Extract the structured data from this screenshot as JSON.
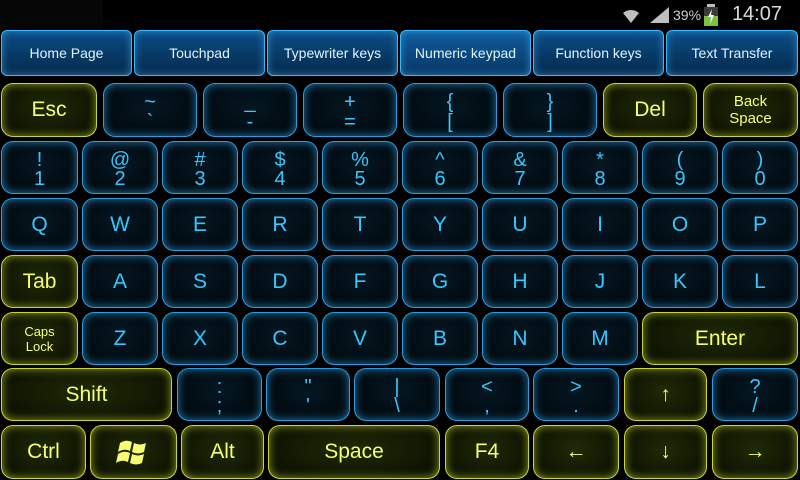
{
  "status_bar": {
    "battery": "39%",
    "time": "14:07"
  },
  "tabs": [
    {
      "label": "Home Page"
    },
    {
      "label": "Touchpad"
    },
    {
      "label": "Typewriter keys"
    },
    {
      "label": "Numeric keypad"
    },
    {
      "label": "Function keys"
    },
    {
      "label": "Text Transfer"
    }
  ],
  "keys": {
    "row1": [
      {
        "c": "Esc"
      },
      {
        "top": "~",
        "bot": "`"
      },
      {
        "top": "_",
        "bot": "-"
      },
      {
        "top": "+",
        "bot": "="
      },
      {
        "top": "{",
        "bot": "["
      },
      {
        "top": "}",
        "bot": "]"
      },
      {
        "c": "Del"
      },
      {
        "c": "Back\nSpace"
      }
    ],
    "row2": [
      {
        "top": "!",
        "bot": "1"
      },
      {
        "top": "@",
        "bot": "2"
      },
      {
        "top": "#",
        "bot": "3"
      },
      {
        "top": "$",
        "bot": "4"
      },
      {
        "top": "%",
        "bot": "5"
      },
      {
        "top": "^",
        "bot": "6"
      },
      {
        "top": "&",
        "bot": "7"
      },
      {
        "top": "*",
        "bot": "8"
      },
      {
        "top": "(",
        "bot": "9"
      },
      {
        "top": ")",
        "bot": "0"
      }
    ],
    "row3": [
      {
        "c": "Q"
      },
      {
        "c": "W"
      },
      {
        "c": "E"
      },
      {
        "c": "R"
      },
      {
        "c": "T"
      },
      {
        "c": "Y"
      },
      {
        "c": "U"
      },
      {
        "c": "I"
      },
      {
        "c": "O"
      },
      {
        "c": "P"
      }
    ],
    "row4": [
      {
        "c": "Tab"
      },
      {
        "c": "A"
      },
      {
        "c": "S"
      },
      {
        "c": "D"
      },
      {
        "c": "F"
      },
      {
        "c": "G"
      },
      {
        "c": "H"
      },
      {
        "c": "J"
      },
      {
        "c": "K"
      },
      {
        "c": "L"
      }
    ],
    "row5": [
      {
        "c": "Caps\nLock"
      },
      {
        "c": "Z"
      },
      {
        "c": "X"
      },
      {
        "c": "C"
      },
      {
        "c": "V"
      },
      {
        "c": "B"
      },
      {
        "c": "N"
      },
      {
        "c": "M"
      },
      {
        "c": "Enter"
      }
    ],
    "row6": [
      {
        "c": "Shift"
      },
      {
        "top": ":",
        "bot": ";"
      },
      {
        "top": "\"",
        "bot": "'"
      },
      {
        "top": "|",
        "bot": "\\"
      },
      {
        "top": "<",
        "bot": ","
      },
      {
        "top": ">",
        "bot": "."
      },
      {
        "c": "↑"
      },
      {
        "top": "?",
        "bot": "/"
      }
    ],
    "row7": [
      {
        "c": "Ctrl"
      },
      {
        "icon": "windows-logo-icon"
      },
      {
        "c": "Alt"
      },
      {
        "c": "Space"
      },
      {
        "c": "F4"
      },
      {
        "c": "←"
      },
      {
        "c": "↓"
      },
      {
        "c": "→"
      }
    ]
  },
  "colors": {
    "accent_blue": "#36c7ff",
    "accent_yellow": "#f6ff74",
    "tab_blue": "#0b4d86"
  }
}
